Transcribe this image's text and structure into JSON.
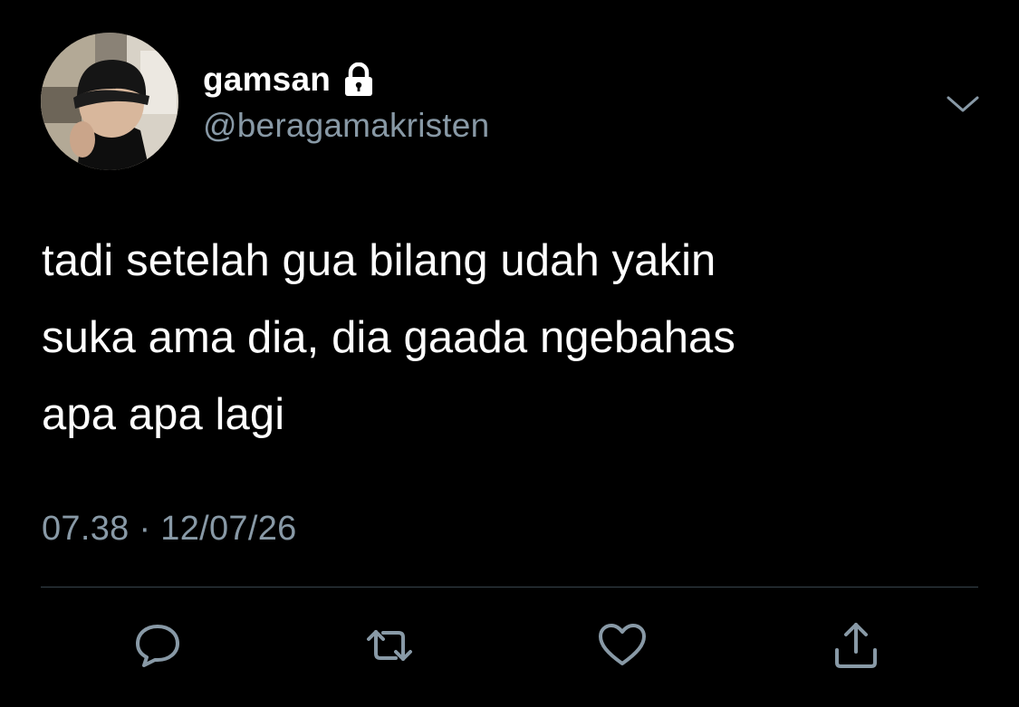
{
  "tweet": {
    "display_name": "gamsan",
    "handle": "@beragamakristen",
    "protected_icon": "lock-icon",
    "text": "tadi setelah gua bilang udah yakin\nsuka ama dia, dia gaada ngebahas\napa apa lagi",
    "timestamp": "07.38 · 12/07/26",
    "menu_icon": "chevron-down-icon"
  },
  "actions": [
    {
      "name": "reply",
      "icon": "speech-bubble-icon"
    },
    {
      "name": "retweet",
      "icon": "retweet-arrows-icon"
    },
    {
      "name": "like",
      "icon": "heart-icon"
    },
    {
      "name": "share",
      "icon": "share-upload-icon"
    }
  ],
  "colors": {
    "background": "#000000",
    "primary_text": "#ffffff",
    "secondary_text": "#8899a6",
    "divider": "#38444d"
  }
}
